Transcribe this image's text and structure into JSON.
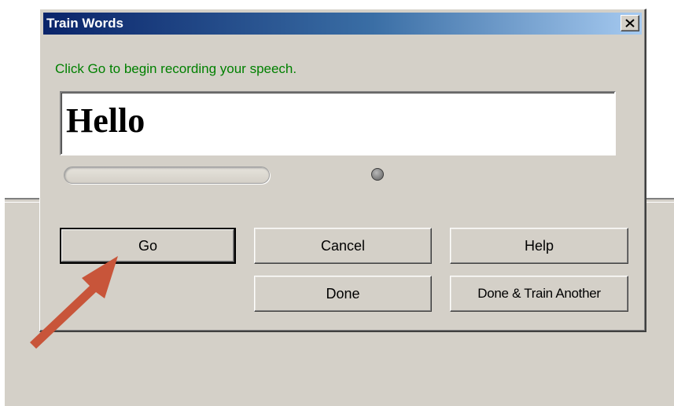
{
  "dialog": {
    "title": "Train Words",
    "close_icon": "close-icon",
    "prompt": "Click Go to begin recording your speech.",
    "word": "Hello",
    "progress_fraction": 0.0,
    "indicator_state": "idle",
    "buttons": {
      "go": "Go",
      "cancel": "Cancel",
      "help": "Help",
      "done": "Done",
      "done_train_another": "Done & Train Another"
    }
  },
  "annotation": {
    "icon": "arrow-icon",
    "color": "#c8553a"
  },
  "colors": {
    "title_start": "#0a246a",
    "title_end": "#a6caf0",
    "prompt_text": "#008000",
    "face": "#d4d0c8"
  }
}
